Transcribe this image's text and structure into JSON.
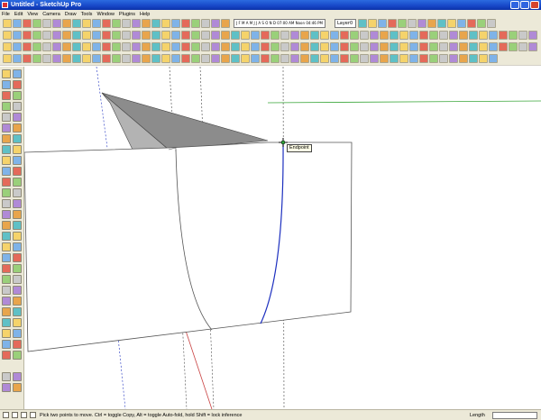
{
  "window": {
    "title": "Untitled - SketchUp Pro"
  },
  "menu": [
    "File",
    "Edit",
    "View",
    "Camera",
    "Draw",
    "Tools",
    "Window",
    "Plugins",
    "Help"
  ],
  "toolbar": {
    "shadow_months": "J F M A M J J A S O N D",
    "shadow_time_start": "07:00 AM",
    "shadow_time_noon": "Noon",
    "shadow_time_end": "04:46 PM",
    "layer_name": "Layer0"
  },
  "canvas": {
    "inference_tooltip": "Endpoint",
    "colors": {
      "edge": "#555555",
      "roof_fill": "#8c8c8c",
      "roof_top": "#c8c8c8",
      "blue_curve": "#1c2fbf",
      "green_axis": "#3aa63a",
      "red_axis": "#c94040"
    }
  },
  "status": {
    "hint": "Pick two points to move.  Ctrl = toggle Copy, Alt = toggle Auto-fold, hold Shift = lock inference",
    "vcb_label": "Length",
    "vcb_value": ""
  }
}
